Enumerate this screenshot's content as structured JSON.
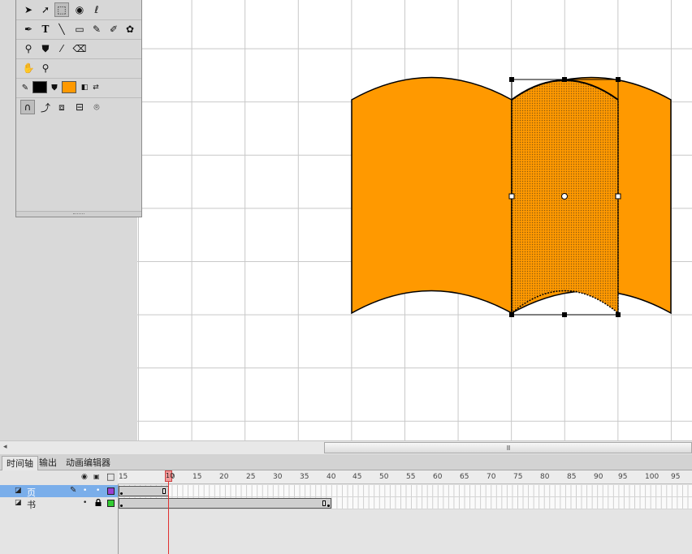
{
  "tools": {
    "rows": [
      [
        "selection-arrow",
        "subselection-arrow",
        "free-transform",
        "3d-rotation",
        "lasso"
      ],
      [
        "pen",
        "text",
        "line",
        "rectangle",
        "pencil",
        "brush",
        "deco"
      ],
      [
        "bone",
        "paint-bucket",
        "eyedropper",
        "eraser"
      ],
      [
        "hand",
        "zoom"
      ],
      [
        "stroke-color",
        "fill-color",
        "swap-colors"
      ],
      [
        "snap-magnet",
        "smooth",
        "straighten",
        "option-a",
        "option-b"
      ]
    ],
    "glyphs": {
      "selection-arrow": "➤",
      "subselection-arrow": "➚",
      "free-transform": "⬚",
      "3d-rotation": "◉",
      "lasso": "ℓ",
      "pen": "✒",
      "text": "T",
      "line": "╲",
      "rectangle": "▭",
      "pencil": "✎",
      "brush": "✐",
      "deco": "✿",
      "bone": "⚲",
      "paint-bucket": "⛊",
      "eyedropper": "⁄",
      "eraser": "⌫",
      "hand": "✋",
      "zoom": "⚲",
      "snap-magnet": "∩",
      "smooth": "⤴",
      "straighten": "⧈",
      "option-a": "⊟",
      "option-b": "⌾"
    },
    "stroke_color": "#000000",
    "fill_color": "#ff9900"
  },
  "stage": {
    "shape_fill": "#ff9900",
    "shape_stroke": "#000000",
    "grid_color": "#c8c8c8",
    "background": "#ffffff"
  },
  "scrollbar": {
    "left_arrow": "◂",
    "thumb_grip": "III"
  },
  "tabs": [
    {
      "label": "时间轴",
      "active": true
    },
    {
      "label": "输出",
      "active": false
    },
    {
      "label": "动画编辑器",
      "active": false
    }
  ],
  "timeline": {
    "ruler_numbers": [
      "1",
      "5",
      "10",
      "15",
      "20",
      "25",
      "30",
      "35",
      "40",
      "45",
      "50",
      "55",
      "60",
      "65",
      "70",
      "75",
      "80",
      "85",
      "90",
      "95",
      "100",
      "95"
    ],
    "current_frame": "10",
    "header_icons": {
      "eye": "◉",
      "lock": "🔒",
      "outline": "□"
    },
    "layers": [
      {
        "name": "页",
        "selected": true,
        "color": "#9b3fd1",
        "span_end_frame": 10
      },
      {
        "name": "书",
        "selected": false,
        "color": "#33cc33",
        "span_end_frame": 40
      }
    ]
  }
}
